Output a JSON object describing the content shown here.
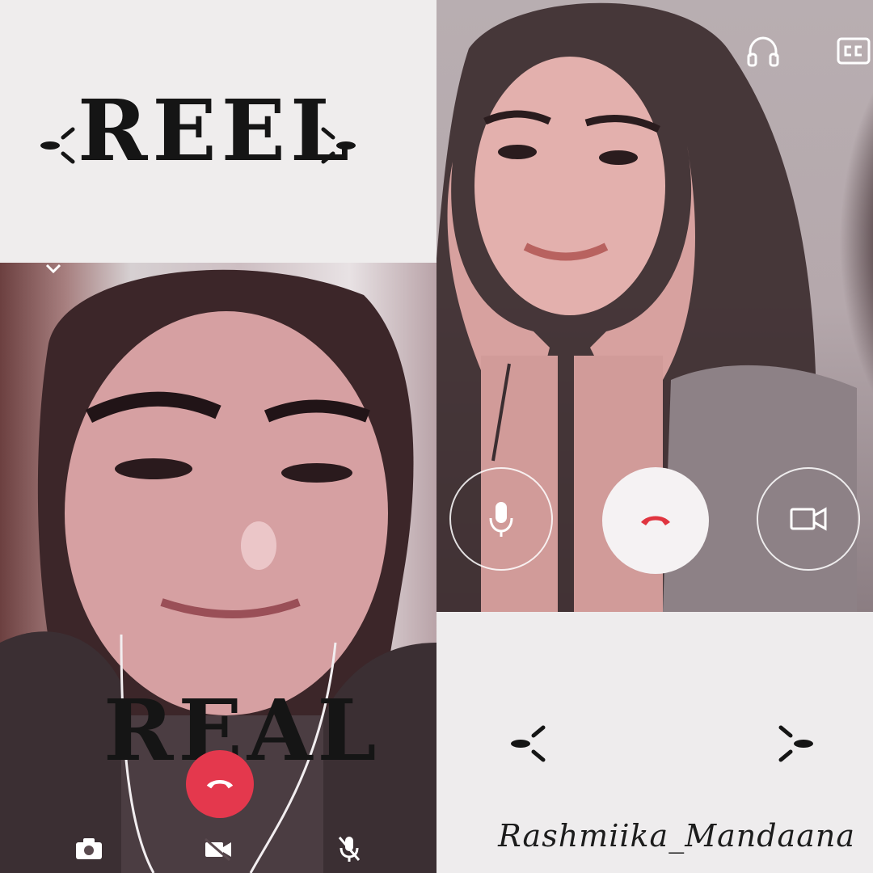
{
  "labels": {
    "top": "REEL",
    "bottom": "REAL"
  },
  "signature": "Rashmiika_Mandaana",
  "icons": {
    "headphones": "headphones-icon",
    "captions": "closed-captions-icon",
    "microphone": "microphone-icon",
    "end_call": "phone-hangup-icon",
    "video": "video-camera-icon",
    "camera_flip": "camera-icon",
    "video_off": "video-off-icon",
    "mute": "mic-off-icon",
    "collapse": "chevron-down-icon"
  },
  "colors": {
    "end_call_red": "#e4384d",
    "end_call_icon_red": "#e0343f",
    "label_text": "#151515"
  }
}
